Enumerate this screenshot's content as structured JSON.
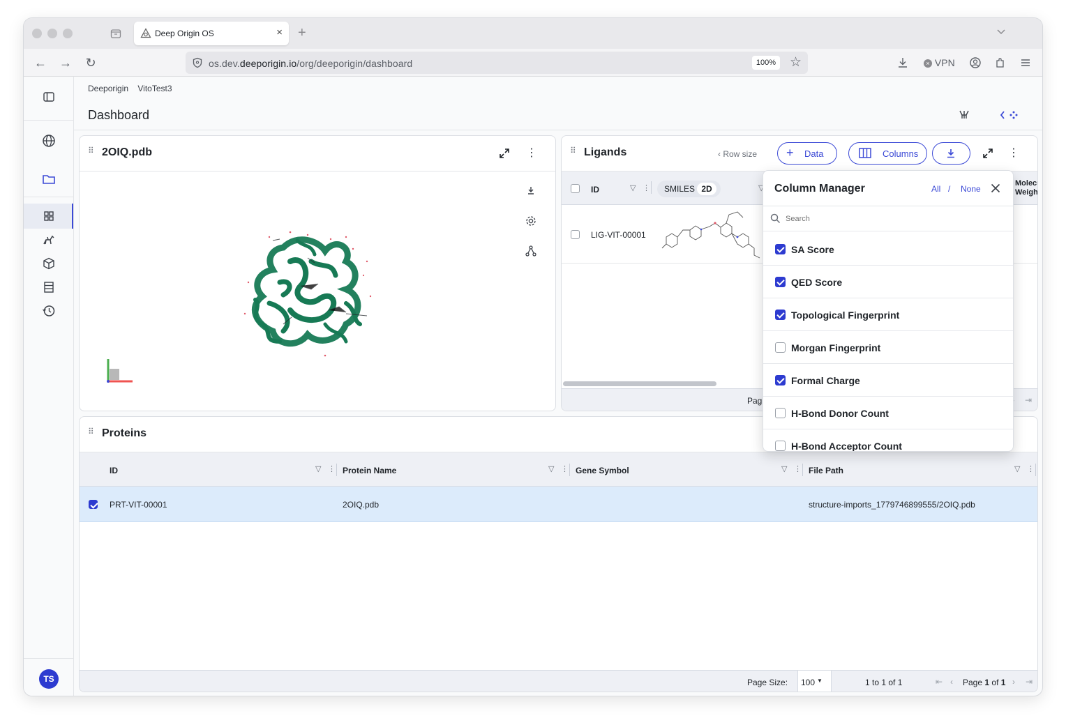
{
  "browser": {
    "tab_title": "Deep Origin OS",
    "url_prefix": "os.dev.",
    "url_domain": "deeporigin.io",
    "url_path": "/org/deeporigin/dashboard",
    "zoom": "100%",
    "vpn_label": "VPN"
  },
  "breadcrumbs": [
    "Deeporigin",
    "VitoTest3"
  ],
  "page_title": "Dashboard",
  "user_initials": "TS",
  "viewer": {
    "title": "2OIQ.pdb"
  },
  "ligands": {
    "title": "Ligands",
    "row_size_label": "Row size",
    "data_button": "Data",
    "columns_button": "Columns",
    "headers": {
      "id": "ID",
      "smiles": "SMILES",
      "smiles_badge": "2D",
      "mol_weight": "Molecu Weight"
    },
    "rows": [
      {
        "id": "LIG-VIT-00001"
      }
    ],
    "footer_page": "Pag"
  },
  "column_manager": {
    "title": "Column Manager",
    "all": "All",
    "slash": "/",
    "none": "None",
    "search_placeholder": "Search",
    "items": [
      {
        "label": "SA Score",
        "checked": true
      },
      {
        "label": "QED Score",
        "checked": true
      },
      {
        "label": "Topological Fingerprint",
        "checked": true
      },
      {
        "label": "Morgan Fingerprint",
        "checked": false
      },
      {
        "label": "Formal Charge",
        "checked": true
      },
      {
        "label": "H-Bond Donor Count",
        "checked": false
      },
      {
        "label": "H-Bond Acceptor Count",
        "checked": false
      }
    ]
  },
  "proteins": {
    "title": "Proteins",
    "headers": {
      "id": "ID",
      "name": "Protein Name",
      "gene": "Gene Symbol",
      "path": "File Path"
    },
    "rows": [
      {
        "id": "PRT-VIT-00001",
        "name": "2OIQ.pdb",
        "gene": "",
        "path": "structure-imports_1779746899555/2OIQ.pdb",
        "checked": true
      }
    ],
    "footer": {
      "page_size_label": "Page Size:",
      "page_size_value": "100",
      "range": "1 to 1 of 1",
      "page_prefix": "Page",
      "page_current": "1",
      "page_of": "of",
      "page_total": "1"
    }
  },
  "colors": {
    "accent": "#3b49d6",
    "protein": "#177a55",
    "row_selected": "#dcebfb"
  }
}
